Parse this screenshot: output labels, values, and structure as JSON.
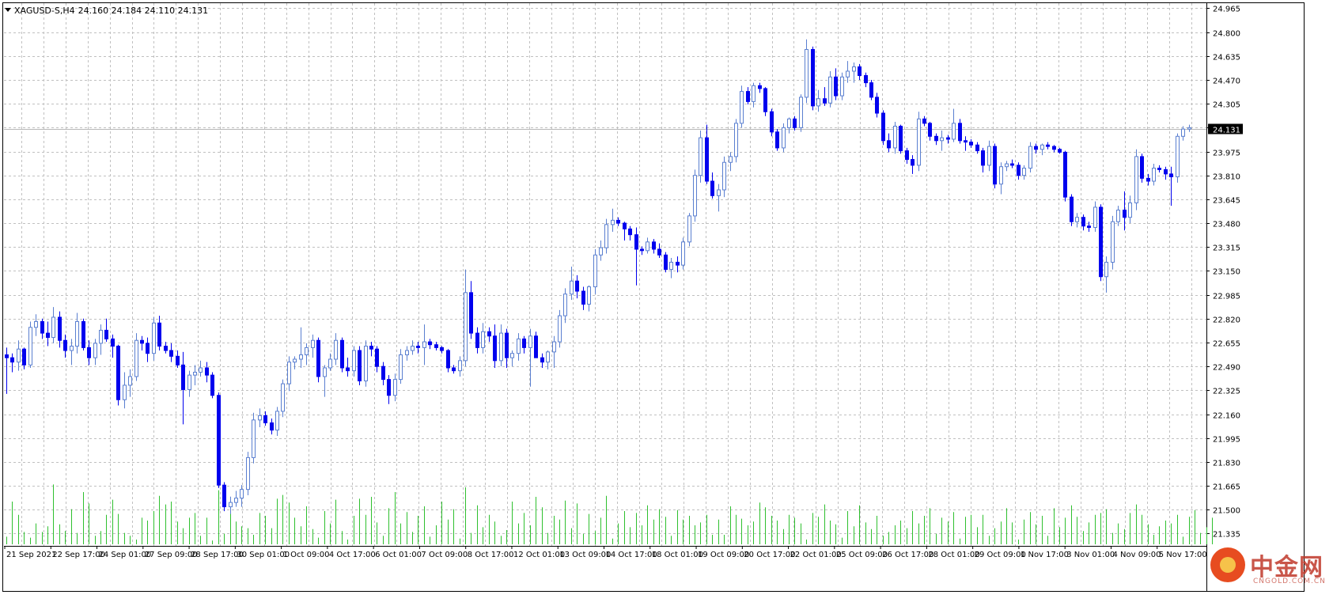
{
  "header": {
    "symbol": "XAGUSD-S,H4",
    "ohlc": "24.160 24.184 24.110 24.131"
  },
  "current_price": "24.131",
  "colors": {
    "bull_candle_stroke": "#5a7fd0",
    "bear_candle": "#0000ee",
    "volume": "#2fc02f",
    "grid": "#c0c0c0",
    "current_price_line": "#b8b8b8",
    "price_tag_bg": "#000000"
  },
  "watermark": {
    "text": "中金网",
    "sub": "CNGOLD.COM.CN",
    "icon": "cngold-logo-icon"
  },
  "chart_data": {
    "type": "candlestick",
    "title": "XAGUSD-S,H4",
    "timeframe": "H4",
    "grid": true,
    "ylim": [
      21.25,
      25.0
    ],
    "y_ticks": [
      "24.965",
      "24.800",
      "24.635",
      "24.470",
      "24.305",
      "24.140",
      "23.975",
      "23.810",
      "23.645",
      "23.480",
      "23.315",
      "23.150",
      "22.985",
      "22.820",
      "22.655",
      "22.490",
      "22.325",
      "22.160",
      "21.995",
      "21.830",
      "21.665",
      "21.500",
      "21.335"
    ],
    "x_ticks": [
      "21 Sep 2021",
      "22 Sep 17:00",
      "24 Sep 01:00",
      "27 Sep 09:00",
      "28 Sep 17:00",
      "30 Sep 01:00",
      "1 Oct 09:00",
      "4 Oct 17:00",
      "6 Oct 01:00",
      "7 Oct 09:00",
      "8 Oct 17:00",
      "12 Oct 01:00",
      "13 Oct 09:00",
      "14 Oct 17:00",
      "18 Oct 01:00",
      "19 Oct 09:00",
      "20 Oct 17:00",
      "22 Oct 01:00",
      "25 Oct 09:00",
      "26 Oct 17:00",
      "28 Oct 01:00",
      "29 Oct 09:00",
      "1 Nov 17:00",
      "3 Nov 01:00",
      "4 Nov 09:00",
      "5 Nov 17:00"
    ],
    "candles": [
      [
        22.57,
        22.62,
        22.3,
        22.55
      ],
      [
        22.55,
        22.58,
        22.45,
        22.52
      ],
      [
        22.52,
        22.67,
        22.46,
        22.61
      ],
      [
        22.61,
        22.62,
        22.47,
        22.5
      ],
      [
        22.5,
        22.8,
        22.48,
        22.76
      ],
      [
        22.76,
        22.85,
        22.7,
        22.8
      ],
      [
        22.8,
        22.82,
        22.68,
        22.72
      ],
      [
        22.72,
        22.8,
        22.63,
        22.69
      ],
      [
        22.69,
        22.9,
        22.65,
        22.83
      ],
      [
        22.83,
        22.87,
        22.62,
        22.67
      ],
      [
        22.67,
        22.71,
        22.55,
        22.6
      ],
      [
        22.6,
        22.68,
        22.5,
        22.63
      ],
      [
        22.63,
        22.86,
        22.58,
        22.8
      ],
      [
        22.8,
        22.82,
        22.6,
        22.62
      ],
      [
        22.62,
        22.67,
        22.5,
        22.55
      ],
      [
        22.55,
        22.68,
        22.5,
        22.65
      ],
      [
        22.65,
        22.78,
        22.57,
        22.74
      ],
      [
        22.74,
        22.82,
        22.66,
        22.68
      ],
      [
        22.68,
        22.71,
        22.55,
        22.63
      ],
      [
        22.63,
        22.64,
        22.22,
        22.26
      ],
      [
        22.26,
        22.45,
        22.2,
        22.36
      ],
      [
        22.36,
        22.47,
        22.28,
        22.42
      ],
      [
        22.42,
        22.72,
        22.39,
        22.67
      ],
      [
        22.67,
        22.7,
        22.6,
        22.65
      ],
      [
        22.65,
        22.69,
        22.52,
        22.58
      ],
      [
        22.58,
        22.83,
        22.53,
        22.79
      ],
      [
        22.79,
        22.84,
        22.6,
        22.63
      ],
      [
        22.63,
        22.66,
        22.58,
        22.6
      ],
      [
        22.6,
        22.65,
        22.52,
        22.56
      ],
      [
        22.56,
        22.6,
        22.48,
        22.5
      ],
      [
        22.5,
        22.59,
        22.09,
        22.33
      ],
      [
        22.33,
        22.46,
        22.28,
        22.43
      ],
      [
        22.43,
        22.5,
        22.36,
        22.45
      ],
      [
        22.45,
        22.53,
        22.42,
        22.48
      ],
      [
        22.48,
        22.52,
        22.38,
        22.43
      ],
      [
        22.43,
        22.45,
        22.27,
        22.29
      ],
      [
        22.29,
        22.31,
        21.65,
        21.67
      ],
      [
        21.67,
        21.69,
        21.49,
        21.52
      ],
      [
        21.52,
        21.59,
        21.47,
        21.55
      ],
      [
        21.55,
        21.63,
        21.52,
        21.58
      ],
      [
        21.58,
        21.67,
        21.52,
        21.64
      ],
      [
        21.64,
        21.9,
        21.6,
        21.86
      ],
      [
        21.86,
        22.17,
        21.82,
        22.12
      ],
      [
        22.12,
        22.2,
        22.07,
        22.15
      ],
      [
        22.15,
        22.18,
        22.08,
        22.1
      ],
      [
        22.1,
        22.13,
        22.02,
        22.05
      ],
      [
        22.05,
        22.21,
        22.01,
        22.18
      ],
      [
        22.18,
        22.4,
        22.14,
        22.37
      ],
      [
        22.37,
        22.56,
        22.32,
        22.52
      ],
      [
        22.52,
        22.56,
        22.47,
        22.54
      ],
      [
        22.54,
        22.76,
        22.48,
        22.57
      ],
      [
        22.57,
        22.65,
        22.5,
        22.62
      ],
      [
        22.62,
        22.71,
        22.55,
        22.67
      ],
      [
        22.67,
        22.69,
        22.38,
        22.42
      ],
      [
        22.42,
        22.5,
        22.28,
        22.48
      ],
      [
        22.48,
        22.58,
        22.46,
        22.54
      ],
      [
        22.54,
        22.72,
        22.5,
        22.67
      ],
      [
        22.67,
        22.69,
        22.45,
        22.48
      ],
      [
        22.48,
        22.55,
        22.42,
        22.46
      ],
      [
        22.46,
        22.63,
        22.42,
        22.6
      ],
      [
        22.6,
        22.63,
        22.36,
        22.39
      ],
      [
        22.39,
        22.67,
        22.35,
        22.63
      ],
      [
        22.63,
        22.66,
        22.56,
        22.61
      ],
      [
        22.61,
        22.63,
        22.45,
        22.49
      ],
      [
        22.49,
        22.52,
        22.36,
        22.4
      ],
      [
        22.4,
        22.43,
        22.23,
        22.29
      ],
      [
        22.29,
        22.44,
        22.25,
        22.4
      ],
      [
        22.4,
        22.61,
        22.37,
        22.57
      ],
      [
        22.57,
        22.63,
        22.53,
        22.6
      ],
      [
        22.6,
        22.67,
        22.57,
        22.63
      ],
      [
        22.63,
        22.66,
        22.58,
        22.62
      ],
      [
        22.62,
        22.78,
        22.5,
        22.66
      ],
      [
        22.66,
        22.68,
        22.61,
        22.64
      ],
      [
        22.64,
        22.66,
        22.6,
        22.62
      ],
      [
        22.62,
        22.63,
        22.58,
        22.6
      ],
      [
        22.6,
        22.61,
        22.45,
        22.48
      ],
      [
        22.48,
        22.5,
        22.44,
        22.46
      ],
      [
        22.46,
        22.56,
        22.42,
        22.53
      ],
      [
        22.53,
        23.16,
        22.49,
        23.0
      ],
      [
        23.0,
        23.08,
        22.68,
        22.72
      ],
      [
        22.72,
        22.76,
        22.58,
        22.62
      ],
      [
        22.62,
        22.79,
        22.58,
        22.73
      ],
      [
        22.73,
        22.76,
        22.66,
        22.7
      ],
      [
        22.7,
        22.78,
        22.48,
        22.53
      ],
      [
        22.53,
        22.78,
        22.49,
        22.72
      ],
      [
        22.72,
        22.75,
        22.48,
        22.55
      ],
      [
        22.55,
        22.6,
        22.49,
        22.58
      ],
      [
        22.58,
        22.72,
        22.53,
        22.68
      ],
      [
        22.68,
        22.7,
        22.58,
        22.62
      ],
      [
        22.62,
        22.75,
        22.35,
        22.7
      ],
      [
        22.7,
        22.73,
        22.58,
        22.55
      ],
      [
        22.55,
        22.58,
        22.48,
        22.52
      ],
      [
        22.52,
        22.6,
        22.47,
        22.59
      ],
      [
        22.59,
        22.7,
        22.48,
        22.66
      ],
      [
        22.66,
        22.88,
        22.62,
        22.84
      ],
      [
        22.84,
        23.03,
        22.79,
        22.99
      ],
      [
        22.99,
        23.18,
        22.95,
        23.08
      ],
      [
        23.08,
        23.12,
        22.96,
        23.01
      ],
      [
        23.01,
        23.04,
        22.88,
        22.92
      ],
      [
        22.92,
        23.05,
        22.87,
        23.04
      ],
      [
        23.04,
        23.3,
        22.99,
        23.26
      ],
      [
        23.26,
        23.36,
        23.22,
        23.31
      ],
      [
        23.31,
        23.51,
        23.27,
        23.47
      ],
      [
        23.47,
        23.58,
        23.42,
        23.5
      ],
      [
        23.5,
        23.52,
        23.46,
        23.48
      ],
      [
        23.48,
        23.49,
        23.36,
        23.44
      ],
      [
        23.44,
        23.46,
        23.36,
        23.4
      ],
      [
        23.4,
        23.45,
        23.05,
        23.3
      ],
      [
        23.3,
        23.32,
        23.26,
        23.29
      ],
      [
        23.29,
        23.38,
        23.27,
        23.35
      ],
      [
        23.35,
        23.37,
        23.27,
        23.3
      ],
      [
        23.3,
        23.34,
        23.24,
        23.26
      ],
      [
        23.26,
        23.28,
        23.14,
        23.16
      ],
      [
        23.16,
        23.24,
        23.1,
        23.21
      ],
      [
        23.21,
        23.25,
        23.14,
        23.19
      ],
      [
        23.19,
        23.38,
        23.16,
        23.35
      ],
      [
        23.35,
        23.55,
        23.32,
        23.53
      ],
      [
        23.53,
        23.85,
        23.49,
        23.81
      ],
      [
        23.81,
        24.12,
        23.76,
        24.07
      ],
      [
        24.07,
        24.16,
        23.75,
        23.77
      ],
      [
        23.77,
        23.83,
        23.65,
        23.67
      ],
      [
        23.67,
        23.75,
        23.56,
        23.71
      ],
      [
        23.71,
        23.94,
        23.66,
        23.9
      ],
      [
        23.9,
        23.97,
        23.84,
        23.94
      ],
      [
        23.94,
        24.2,
        23.9,
        24.17
      ],
      [
        24.17,
        24.43,
        24.14,
        24.39
      ],
      [
        24.39,
        24.42,
        24.3,
        24.32
      ],
      [
        24.32,
        24.45,
        24.28,
        24.43
      ],
      [
        24.43,
        24.45,
        24.38,
        24.41
      ],
      [
        24.41,
        24.42,
        24.22,
        24.25
      ],
      [
        24.25,
        24.27,
        24.08,
        24.11
      ],
      [
        24.11,
        24.13,
        23.98,
        24.0
      ],
      [
        24.0,
        24.17,
        23.97,
        24.14
      ],
      [
        24.14,
        24.21,
        24.1,
        24.2
      ],
      [
        24.2,
        24.22,
        24.12,
        24.14
      ],
      [
        24.14,
        24.37,
        24.11,
        24.35
      ],
      [
        24.35,
        24.75,
        24.31,
        24.68
      ],
      [
        24.68,
        24.7,
        24.26,
        24.29
      ],
      [
        24.29,
        24.4,
        24.25,
        24.34
      ],
      [
        24.34,
        24.42,
        24.29,
        24.31
      ],
      [
        24.31,
        24.53,
        24.28,
        24.49
      ],
      [
        24.49,
        24.55,
        24.33,
        24.36
      ],
      [
        24.36,
        24.52,
        24.33,
        24.49
      ],
      [
        24.49,
        24.6,
        24.45,
        24.53
      ],
      [
        24.53,
        24.59,
        24.45,
        24.56
      ],
      [
        24.56,
        24.58,
        24.47,
        24.5
      ],
      [
        24.5,
        24.52,
        24.42,
        24.45
      ],
      [
        24.45,
        24.47,
        24.33,
        24.35
      ],
      [
        24.35,
        24.38,
        24.21,
        24.24
      ],
      [
        24.24,
        24.26,
        24.02,
        24.05
      ],
      [
        24.05,
        24.1,
        23.97,
        24.0
      ],
      [
        24.0,
        24.18,
        23.96,
        24.15
      ],
      [
        24.15,
        24.16,
        23.96,
        23.98
      ],
      [
        23.98,
        24.0,
        23.89,
        23.92
      ],
      [
        23.92,
        23.95,
        23.82,
        23.88
      ],
      [
        23.88,
        24.25,
        23.84,
        24.2
      ],
      [
        24.2,
        24.22,
        24.15,
        24.17
      ],
      [
        24.17,
        24.18,
        24.05,
        24.08
      ],
      [
        24.08,
        24.1,
        24.02,
        24.05
      ],
      [
        24.05,
        24.12,
        23.98,
        24.07
      ],
      [
        24.07,
        24.09,
        24.03,
        24.06
      ],
      [
        24.06,
        24.27,
        24.04,
        24.17
      ],
      [
        24.17,
        24.2,
        24.03,
        24.05
      ],
      [
        24.05,
        24.08,
        23.98,
        24.04
      ],
      [
        24.04,
        24.06,
        24.0,
        24.02
      ],
      [
        24.02,
        24.04,
        23.96,
        23.98
      ],
      [
        23.98,
        24.0,
        23.83,
        23.88
      ],
      [
        23.88,
        24.05,
        23.84,
        24.01
      ],
      [
        24.01,
        24.03,
        23.72,
        23.75
      ],
      [
        23.75,
        23.9,
        23.68,
        23.87
      ],
      [
        23.87,
        23.91,
        23.84,
        23.89
      ],
      [
        23.89,
        23.92,
        23.86,
        23.88
      ],
      [
        23.88,
        23.9,
        23.78,
        23.81
      ],
      [
        23.81,
        23.88,
        23.78,
        23.86
      ],
      [
        23.86,
        24.04,
        23.83,
        24.01
      ],
      [
        24.01,
        24.03,
        23.96,
        23.99
      ],
      [
        23.99,
        24.03,
        23.95,
        24.02
      ],
      [
        24.02,
        24.04,
        23.99,
        24.01
      ],
      [
        24.01,
        24.02,
        23.97,
        23.99
      ],
      [
        23.99,
        24.0,
        23.96,
        23.97
      ],
      [
        23.97,
        23.98,
        23.63,
        23.66
      ],
      [
        23.66,
        23.68,
        23.46,
        23.49
      ],
      [
        23.49,
        23.55,
        23.45,
        23.52
      ],
      [
        23.52,
        23.54,
        23.43,
        23.46
      ],
      [
        23.46,
        23.49,
        23.42,
        23.45
      ],
      [
        23.45,
        23.63,
        23.42,
        23.59
      ],
      [
        23.59,
        23.61,
        23.08,
        23.11
      ],
      [
        23.11,
        23.25,
        23.0,
        23.21
      ],
      [
        23.21,
        23.53,
        23.16,
        23.49
      ],
      [
        23.49,
        23.6,
        23.46,
        23.57
      ],
      [
        23.57,
        23.7,
        23.43,
        23.52
      ],
      [
        23.52,
        23.67,
        23.48,
        23.62
      ],
      [
        23.62,
        23.99,
        23.57,
        23.94
      ],
      [
        23.94,
        23.96,
        23.76,
        23.79
      ],
      [
        23.79,
        23.82,
        23.74,
        23.77
      ],
      [
        23.77,
        23.89,
        23.74,
        23.86
      ],
      [
        23.86,
        23.88,
        23.83,
        23.85
      ],
      [
        23.85,
        23.87,
        23.78,
        23.82
      ],
      [
        23.82,
        23.87,
        23.6,
        23.8
      ],
      [
        23.8,
        24.1,
        23.76,
        24.08
      ],
      [
        24.08,
        24.15,
        24.05,
        24.13
      ],
      [
        24.13,
        24.16,
        24.11,
        24.14
      ]
    ],
    "volumes": [
      8,
      45,
      31,
      13,
      7,
      22,
      13,
      19,
      63,
      21,
      14,
      37,
      12,
      55,
      43,
      9,
      14,
      31,
      47,
      32,
      12,
      9,
      5,
      28,
      25,
      35,
      51,
      42,
      45,
      24,
      17,
      28,
      33,
      9,
      28,
      4,
      57,
      11,
      48,
      24,
      19,
      17,
      10,
      33,
      30,
      17,
      48,
      52,
      44,
      28,
      19,
      40,
      16,
      7,
      35,
      22,
      47,
      14,
      5,
      30,
      48,
      31,
      50,
      23,
      9,
      38,
      55,
      22,
      34,
      13,
      30,
      40,
      8,
      20,
      45,
      26,
      37,
      6,
      60,
      12,
      41,
      18,
      31,
      24,
      9,
      15,
      45,
      22,
      33,
      20,
      50,
      39,
      12,
      30,
      26,
      46,
      17,
      43,
      11,
      32,
      14,
      28,
      51,
      6,
      22,
      35,
      18,
      33,
      20,
      41,
      26,
      37,
      29,
      9,
      36,
      26,
      30,
      20,
      23,
      31,
      10,
      26,
      10,
      40,
      31,
      27,
      20,
      24,
      44,
      39,
      30,
      25,
      16,
      31,
      28,
      22,
      5,
      33,
      29,
      42,
      25,
      21,
      7,
      35,
      19,
      41,
      23,
      16,
      30,
      9,
      13,
      20,
      25,
      17,
      35,
      22,
      30,
      38,
      11,
      28,
      24,
      34,
      6,
      29,
      31,
      18,
      31,
      9,
      17,
      24,
      38,
      23,
      5,
      26,
      34,
      21,
      30,
      9,
      38,
      18,
      28,
      41,
      29,
      14,
      23,
      31,
      33,
      37,
      12,
      22,
      16,
      33,
      42,
      31,
      21,
      10,
      19,
      25,
      22,
      31,
      8,
      29,
      36,
      12,
      18,
      28
    ]
  }
}
